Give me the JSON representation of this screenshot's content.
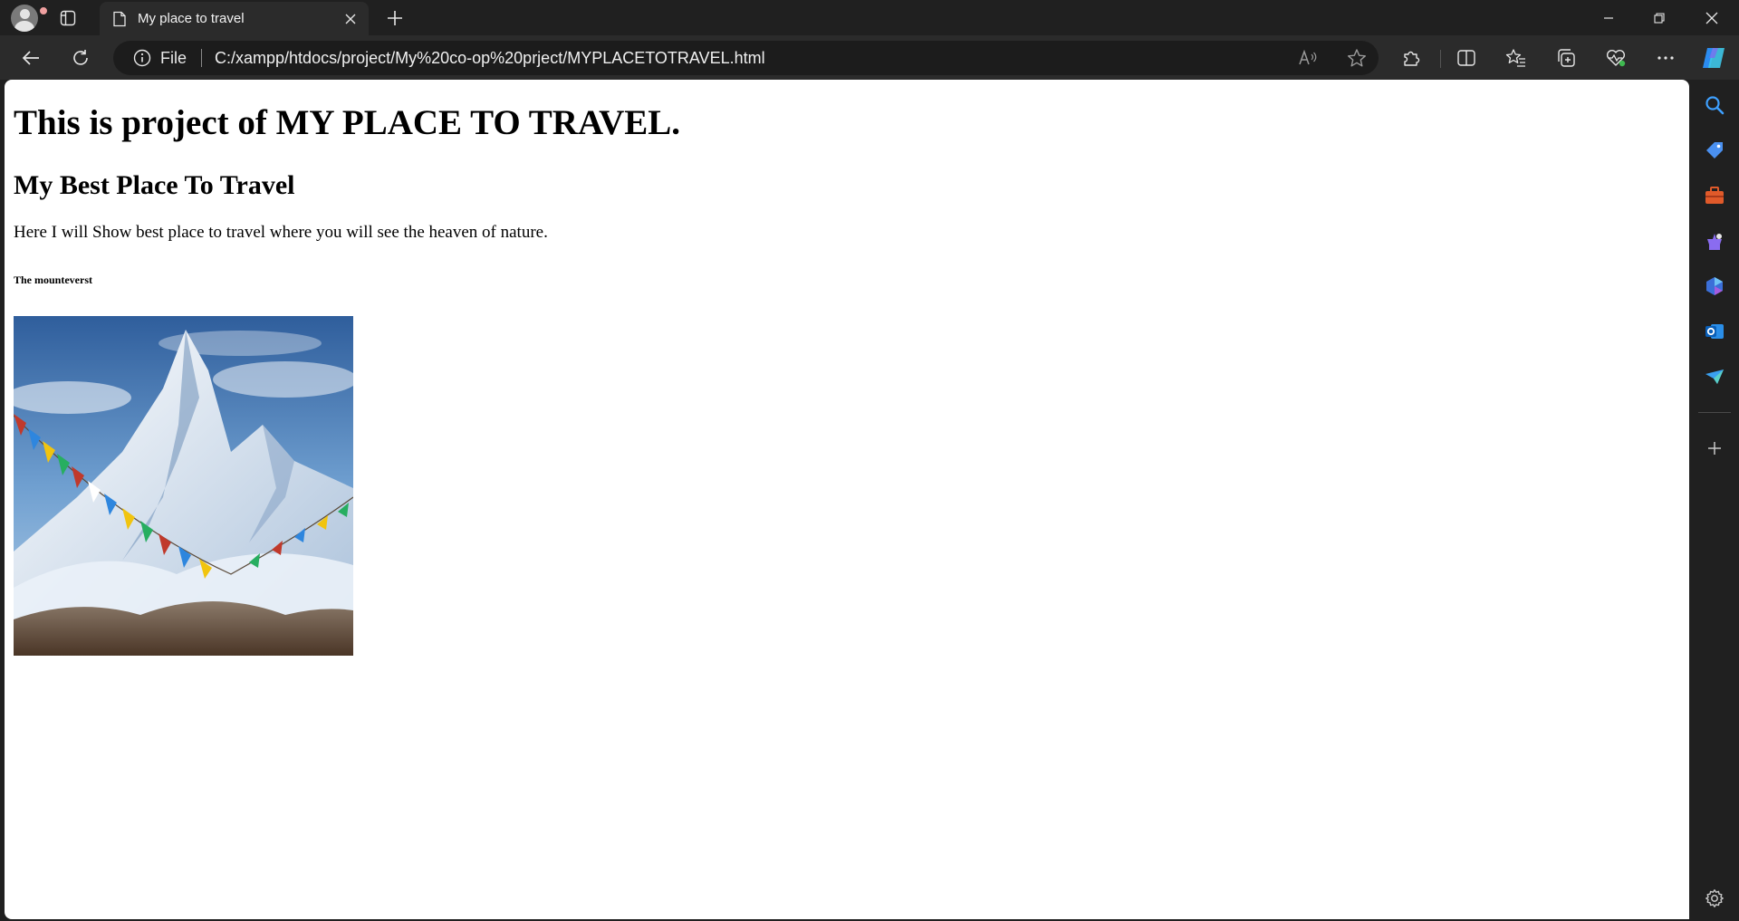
{
  "browser": {
    "tab": {
      "title": "My place to travel"
    },
    "address_bar": {
      "scheme_label": "File",
      "url": "C:/xampp/htdocs/project/My%20co-op%20prject/MYPLACETOTRAVEL.html"
    }
  },
  "page": {
    "heading1": "This is project of MY PLACE TO TRAVEL.",
    "heading2": "My Best Place To Travel",
    "paragraph": "Here I will Show best place to travel where you will see the heaven of nature.",
    "heading5": "The mounteverst",
    "image": {
      "subject": "Snow-covered mountain peak with Tibetan prayer flags"
    }
  },
  "sidebar": {
    "items": [
      "search-icon",
      "shopping-tag-icon",
      "tools-icon",
      "games-icon",
      "copilot-icon",
      "outlook-icon",
      "drop-icon",
      "add-icon",
      "settings-icon"
    ]
  },
  "colors": {
    "chrome_dark": "#202020",
    "toolbar": "#2b2b2b",
    "omnibox": "#1c1c1c",
    "page_bg": "#ffffff"
  }
}
